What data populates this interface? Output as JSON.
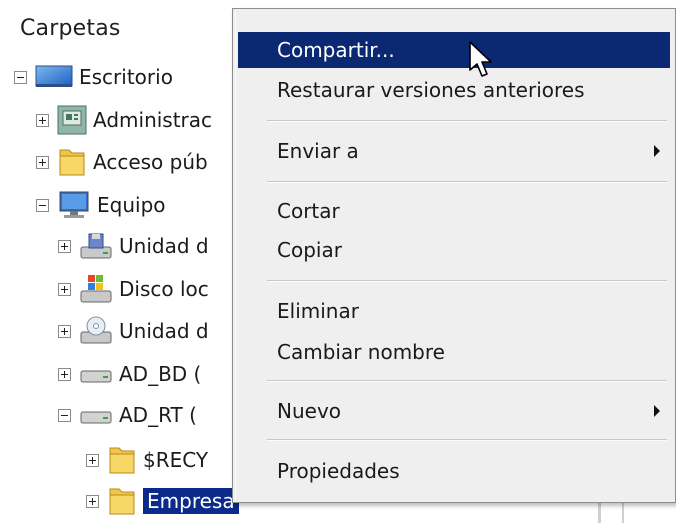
{
  "tree": {
    "title": "Carpetas",
    "nodes": [
      {
        "label": "Escritorio",
        "expander": "minus",
        "icon": "desktop-icon"
      },
      {
        "label": "Administrac",
        "expander": "plus",
        "icon": "control-panel-icon"
      },
      {
        "label": "Acceso púb",
        "expander": "plus",
        "icon": "folder-icon"
      },
      {
        "label": "Equipo",
        "expander": "minus",
        "icon": "computer-icon"
      },
      {
        "label": "Unidad d",
        "expander": "plus",
        "icon": "floppy-drive-icon"
      },
      {
        "label": "Disco loc",
        "expander": "plus",
        "icon": "windows-drive-icon"
      },
      {
        "label": "Unidad d",
        "expander": "plus",
        "icon": "dvd-drive-icon"
      },
      {
        "label": "AD_BD (",
        "expander": "plus",
        "icon": "drive-icon"
      },
      {
        "label": "AD_RT (",
        "expander": "minus",
        "icon": "drive-icon"
      },
      {
        "label": "$RECY",
        "expander": "plus",
        "icon": "folder-icon"
      },
      {
        "label": "Empresa",
        "expander": "plus",
        "icon": "folder-icon",
        "selected": true
      }
    ]
  },
  "context_menu": {
    "items": {
      "share": "Compartir...",
      "restore": "Restaurar versiones anteriores",
      "send_to": "Enviar a",
      "cut": "Cortar",
      "copy": "Copiar",
      "delete": "Eliminar",
      "rename": "Cambiar nombre",
      "new": "Nuevo",
      "properties": "Propiedades"
    },
    "highlighted": "share",
    "submenus": [
      "send_to",
      "new"
    ]
  },
  "colors": {
    "menu_highlight": "#0b2872",
    "tree_selection": "#0b2a8a",
    "menu_background": "#efefef"
  }
}
